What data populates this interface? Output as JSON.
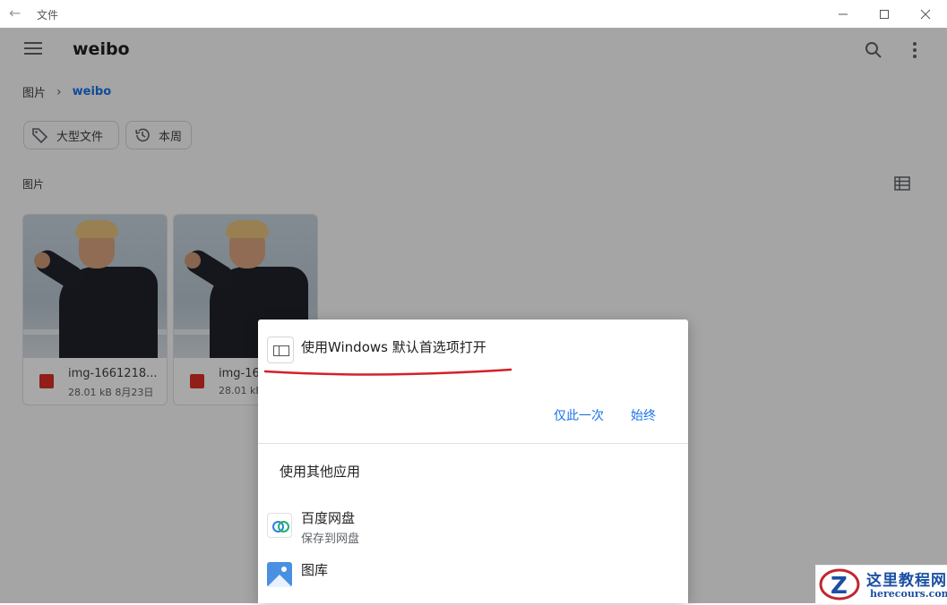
{
  "window": {
    "title": "文件"
  },
  "appbar": {
    "title": "weibo"
  },
  "breadcrumb": {
    "root": "图片",
    "current": "weibo"
  },
  "chips": {
    "large_files": "大型文件",
    "this_week": "本周"
  },
  "section": {
    "label": "图片"
  },
  "files": [
    {
      "name": "img-1661218...",
      "size": "28.01 kB",
      "date": "8月23日"
    },
    {
      "name": "img-16...",
      "size": "28.01 kB",
      "date": ""
    }
  ],
  "dialog": {
    "default_title": "使用Windows 默认首选项打开",
    "once": "仅此一次",
    "always": "始终",
    "other_apps": "使用其他应用",
    "apps": [
      {
        "name": "百度网盘",
        "sub": "保存到网盘"
      },
      {
        "name": "图库",
        "sub": ""
      }
    ]
  },
  "watermark": {
    "cn": "这里教程网",
    "en": "herecours.com"
  },
  "colors": {
    "accent": "#1a73e8",
    "underline": "#d4202a"
  }
}
